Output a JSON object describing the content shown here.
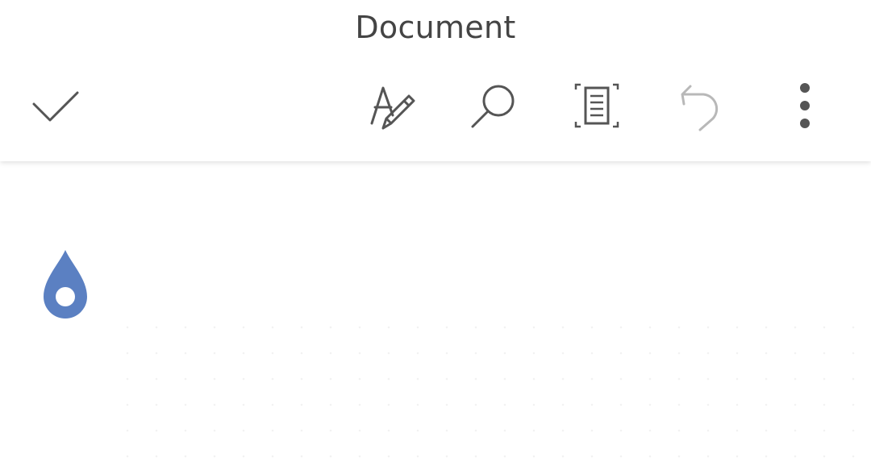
{
  "app": {
    "title": "Document"
  },
  "toolbar": {
    "done_icon": "checkmark-icon",
    "format_icon": "text-format-pen-icon",
    "search_icon": "search-icon",
    "view_icon": "reading-view-icon",
    "undo_icon": "undo-icon",
    "undo_enabled": false,
    "more_icon": "more-vertical-icon"
  },
  "colors": {
    "icon": "#555555",
    "icon_disabled": "#b8b8b8",
    "title": "#444444",
    "accent": "#5b80c2"
  },
  "editor": {
    "cursor_handle_icon": "cursor-drop-handle-icon"
  }
}
